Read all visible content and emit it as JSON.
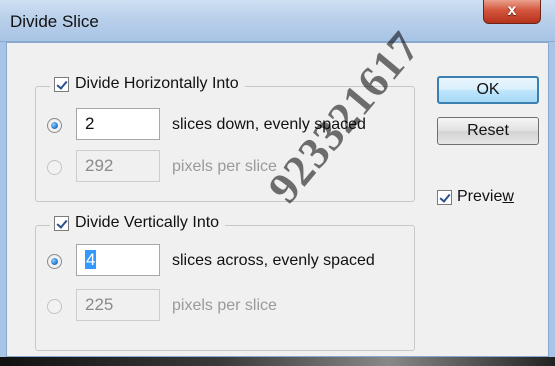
{
  "window": {
    "title": "Divide Slice",
    "close_label": "x"
  },
  "horizontal": {
    "label": "Divide Horizontally Into",
    "checked": true,
    "slices_value": "2",
    "slices_label": "slices down, evenly spaced",
    "pixels_value": "292",
    "pixels_label": "pixels per slice"
  },
  "vertical": {
    "label": "Divide Vertically Into",
    "checked": true,
    "slices_value": "4",
    "slices_label": "slices across, evenly spaced",
    "pixels_value": "225",
    "pixels_label": "pixels per slice"
  },
  "buttons": {
    "ok": "OK",
    "reset": "Reset"
  },
  "preview": {
    "label_main": "Previe",
    "label_accel": "w",
    "checked": true
  },
  "watermark": "923321617"
}
